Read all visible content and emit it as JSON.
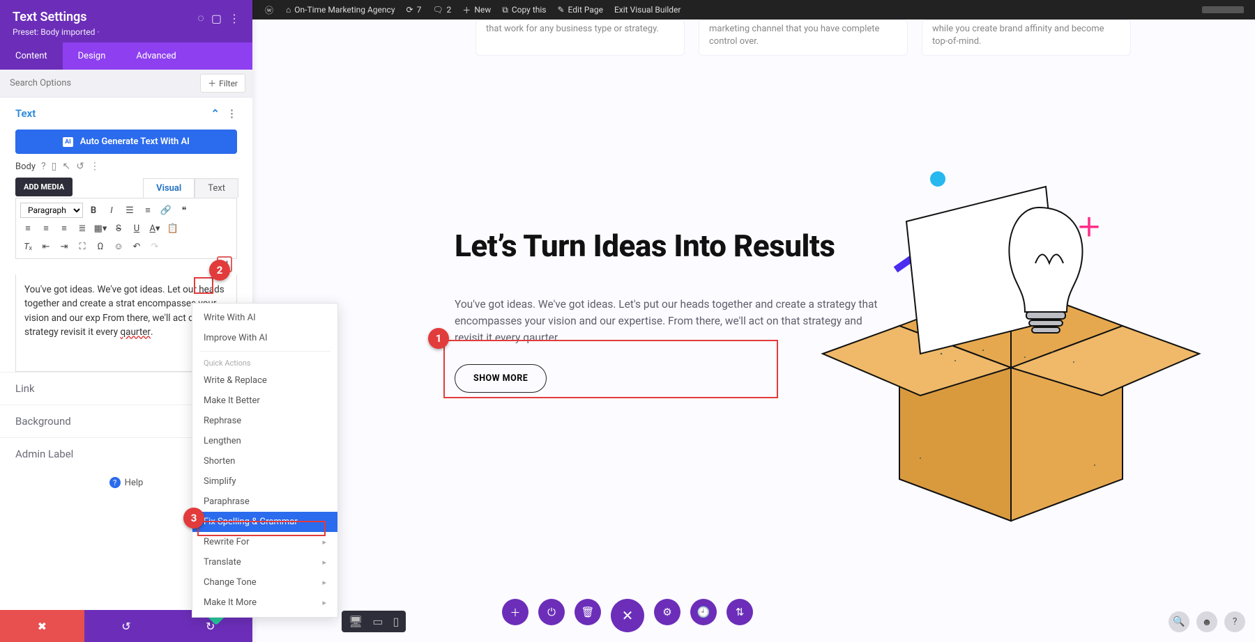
{
  "wpbar": {
    "site": "On-Time Marketing Agency",
    "updates": "7",
    "comments": "2",
    "new": "New",
    "copy": "Copy this",
    "edit": "Edit Page",
    "exit": "Exit Visual Builder"
  },
  "sidebar": {
    "title": "Text Settings",
    "preset": "Preset: Body imported ·",
    "tabs": {
      "content": "Content",
      "design": "Design",
      "advanced": "Advanced"
    },
    "search_placeholder": "Search Options",
    "filter": "Filter",
    "text_group": "Text",
    "ai_button": "Auto Generate Text With AI",
    "ai_badge": "AI",
    "body_label": "Body",
    "add_media": "ADD MEDIA",
    "editor_tabs": {
      "visual": "Visual",
      "text": "Text"
    },
    "paragraph": "Paragraph",
    "editor_pre": "You've got ideas. We've got ideas. Let our heads together and create a strat encompasses your vision and our exp From there, we'll act on that strategy revisit it every ",
    "editor_typo": "qaurter",
    "sections": {
      "link": "Link",
      "background": "Background",
      "admin_label": "Admin Label"
    },
    "help": "Help",
    "ai_handle": "AI"
  },
  "ai_menu": {
    "write": "Write With AI",
    "improve": "Improve With AI",
    "quick": "Quick Actions",
    "items": [
      "Write & Replace",
      "Make It Better",
      "Rephrase",
      "Lengthen",
      "Shorten",
      "Simplify",
      "Paraphrase",
      "Fix Spelling & Grammar",
      "Rewrite For",
      "Translate",
      "Change Tone",
      "Make It More"
    ]
  },
  "canvas": {
    "card1": "that work for any business type or strategy.",
    "card2": "marketing channel that you have complete control over.",
    "card3": "while you create brand affinity and become top-of-mind.",
    "hero_title": "Let’s Turn Ideas Into Results",
    "hero_p": "You've got ideas. We've got ideas. Let's put our heads together and create a strategy that encompasses your vision and our expertise. From there, we'll act on that strategy and revisit it every qaurter.",
    "show_more": "SHOW MORE"
  },
  "anno": {
    "n1": "1",
    "n2": "2",
    "n3": "3"
  }
}
